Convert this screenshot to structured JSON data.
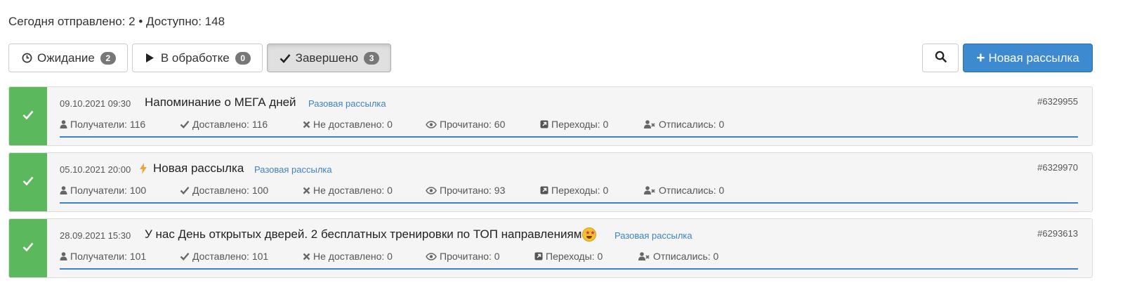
{
  "stats": {
    "sent_label": "Сегодня отправлено: 2",
    "separator": " • ",
    "available_label": "Доступно: 148"
  },
  "tabs": [
    {
      "label": "Ожидание",
      "count": "2",
      "icon": "clock-icon"
    },
    {
      "label": "В обработке",
      "count": "0",
      "icon": "play-icon"
    },
    {
      "label": "Завершено",
      "count": "3",
      "icon": "check-icon",
      "active": true
    }
  ],
  "toolbar": {
    "search_icon": "search-icon",
    "new_label": "Новая рассылка",
    "new_color": "#3d8ad0"
  },
  "colors": {
    "status_done": "#5cb85c",
    "link": "#3f82c2",
    "progress": "#3a82cc"
  },
  "mailings": [
    {
      "date": "09.10.2021 09:30",
      "title": "Напоминание о МЕГА дней",
      "type": "Разовая рассылка",
      "id": "#6329955",
      "recipients": "Получатели: 116",
      "delivered": "Доставлено: 116",
      "not_delivered": "Не доставлено: 0",
      "read": "Прочитано: 60",
      "clicks": "Переходы: 0",
      "unsubscribed": "Отписались: 0",
      "progress": 1.0
    },
    {
      "date": "05.10.2021 20:00",
      "flash_icon": "bolt-icon",
      "title": "Новая рассылка",
      "type": "Разовая рассылка",
      "id": "#6329970",
      "recipients": "Получатели: 100",
      "delivered": "Доставлено: 100",
      "not_delivered": "Не доставлено: 0",
      "read": "Прочитано: 93",
      "clicks": "Переходы: 0",
      "unsubscribed": "Отписались: 0",
      "progress": 1.0
    },
    {
      "date": "28.09.2021 15:30",
      "title": "У нас День открытых дверей. 2 бесплатных тренировки по ТОП направлениям",
      "emoji": "star-struck-emoji",
      "type": "Разовая рассылка",
      "id": "#6293613",
      "recipients": "Получатели: 101",
      "delivered": "Доставлено: 101",
      "not_delivered": "Не доставлено: 0",
      "read": "Прочитано: 0",
      "clicks": "Переходы: 0",
      "unsubscribed": "Отписались: 0",
      "progress": 1.0
    }
  ]
}
